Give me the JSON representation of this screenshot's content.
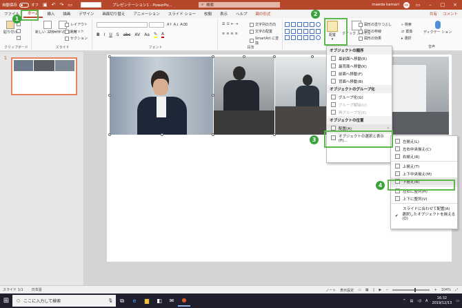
{
  "window": {
    "autosave_label": "自動保存",
    "autosave_state": "オフ",
    "filename_suffix": "プレゼンテーション1 - PowerPo...",
    "search_placeholder": "検索",
    "user_name": "maeda kamari",
    "avatar_initials": "MK"
  },
  "tabs": [
    "ファイル",
    "ホーム",
    "挿入",
    "描画",
    "デザイン",
    "画面切り替え",
    "アニメーション",
    "スライド ショー",
    "校閲",
    "表示",
    "ヘルプ",
    "図の形式"
  ],
  "tab_right": {
    "share": "共有",
    "comments": "コメント"
  },
  "ribbon": {
    "clipboard": {
      "paste": "貼り付け",
      "label": "クリップボード"
    },
    "slides": {
      "new_slide": "新しい\nスライド",
      "reuse": "スライドの\n再利用",
      "layout": "レイアウト",
      "reset": "リセット",
      "section": "セクション",
      "label": "スライド"
    },
    "font": {
      "label": "フォント"
    },
    "paragraph": {
      "dir": "文字列の方向",
      "align": "文字の配置",
      "smartart": "SmartArt に変換",
      "label": "段落"
    },
    "drawing": {
      "arrange": "配置",
      "quick": "クイック\nスタイル",
      "fill": "図形の塗りつぶし",
      "outline": "図形の枠線",
      "effect": "図形の効果"
    },
    "editing": {
      "find": "検索",
      "replace": "置換",
      "select": "選択"
    },
    "voice": {
      "dictate": "ディクテー\nション",
      "label": "音声"
    }
  },
  "callouts": [
    "1",
    "2",
    "3",
    "4"
  ],
  "slide_panel": {
    "number": "1"
  },
  "arrange_menu": {
    "header_order": "オブジェクトの順序",
    "order_items": [
      "最前面へ移動(R)",
      "最背面へ移動(K)",
      "前面へ移動(F)",
      "背面へ移動(B)"
    ],
    "header_group": "オブジェクトのグループ化",
    "group_items": [
      "グループ化(G)",
      "グループ解除(U)",
      "再グループ化(E)"
    ],
    "header_position": "オブジェクトの位置",
    "align_item": "配置(A)",
    "selection_pane": "オブジェクトの選択と表示(P)..."
  },
  "align_submenu": {
    "items": [
      "左揃え(L)",
      "左右中央揃え(C)",
      "右揃え(R)",
      "上揃え(T)",
      "上下中央揃え(M)",
      "下揃え(B)",
      "左右に整列(H)",
      "上下に整列(V)"
    ],
    "slide_align": "スライドに合わせて配置(A)",
    "selected_align": "選択したオブジェクトを揃える(O)"
  },
  "status": {
    "slide": "スライド 1/1",
    "language": "日本語",
    "notes": "ノート",
    "display": "表示設定",
    "zoom": "104%"
  },
  "taskbar": {
    "search": "ここに入力して検索",
    "time": "16:32",
    "date": "2019/12/13",
    "ime": "A"
  },
  "colors": {
    "accent": "#b7472a",
    "highlight": "#5cb84a",
    "callout": "#3aa33a"
  }
}
